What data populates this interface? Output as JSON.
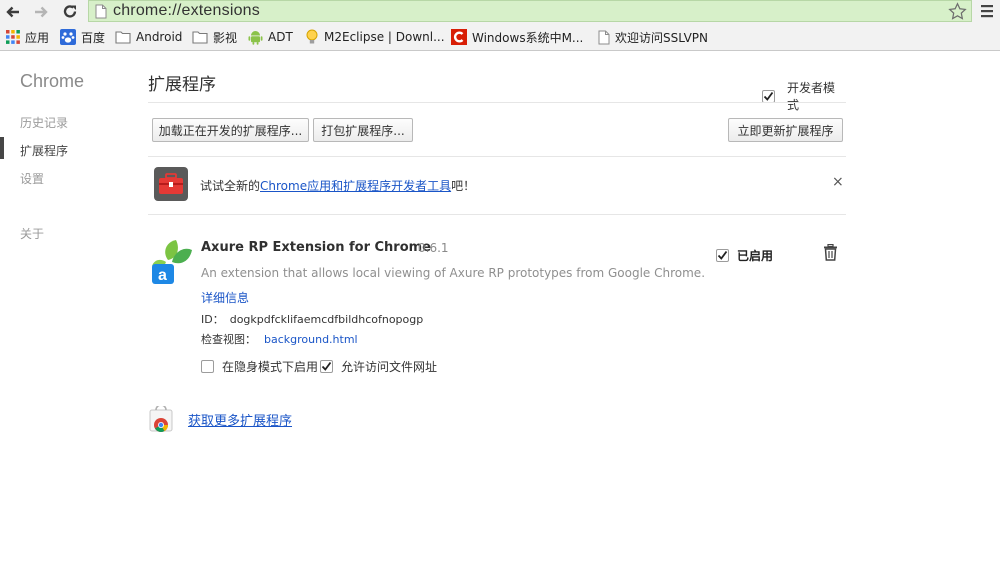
{
  "toolbar": {
    "url": "chrome://extensions",
    "icons": [
      "back-icon",
      "forward-icon",
      "reload-icon",
      "page-icon",
      "star-icon",
      "menu-icon"
    ]
  },
  "bookmarks": [
    {
      "label": "应用",
      "icon": "apps-grid-icon"
    },
    {
      "label": "百度",
      "icon": "baidu-paw-icon"
    },
    {
      "label": "Android",
      "icon": "folder-icon"
    },
    {
      "label": "影视",
      "icon": "folder-icon"
    },
    {
      "label": "ADT",
      "icon": "android-robot-icon"
    },
    {
      "label": "M2Eclipse | Downl...",
      "icon": "bulb-icon"
    },
    {
      "label": "Windows系统中M...",
      "icon": "red-c-icon"
    },
    {
      "label": "欢迎访问SSLVPN",
      "icon": "page-icon"
    }
  ],
  "sidebar": {
    "brand": "Chrome",
    "items": [
      {
        "label": "历史记录",
        "active": false
      },
      {
        "label": "扩展程序",
        "active": true
      },
      {
        "label": "设置",
        "active": false
      },
      {
        "label": "关于",
        "active": false
      }
    ]
  },
  "main": {
    "title": "扩展程序",
    "developer_mode": {
      "label": "开发者模式",
      "checked": true
    },
    "buttons": {
      "load_unpacked": "加载正在开发的扩展程序...",
      "pack": "打包扩展程序...",
      "update_now": "立即更新扩展程序"
    },
    "promo": {
      "prefix": "试试全新的",
      "link": "Chrome应用和扩展程序开发者工具",
      "suffix": "吧！",
      "close": "×"
    },
    "extension": {
      "name": "Axure RP Extension for Chrome",
      "version": "0.6.1",
      "description": "An extension that allows local viewing of Axure RP prototypes from Google Chrome.",
      "details_link": "详细信息",
      "id_label": "ID：",
      "id_value": "dogkpdfcklifaemcdfbildhcofnopogp",
      "views_label": "检查视图：",
      "views_link": "background.html",
      "incognito_label": "在隐身模式下启用",
      "incognito_checked": false,
      "file_access_label": "允许访问文件网址",
      "file_access_checked": true,
      "enabled_label": "已启用",
      "enabled_checked": true
    },
    "get_more": "获取更多扩展程序"
  },
  "colors": {
    "omnibox_bg": "#d7f0c9",
    "link": "#1a55c7",
    "chrome_bg": "#f2f2f2"
  }
}
